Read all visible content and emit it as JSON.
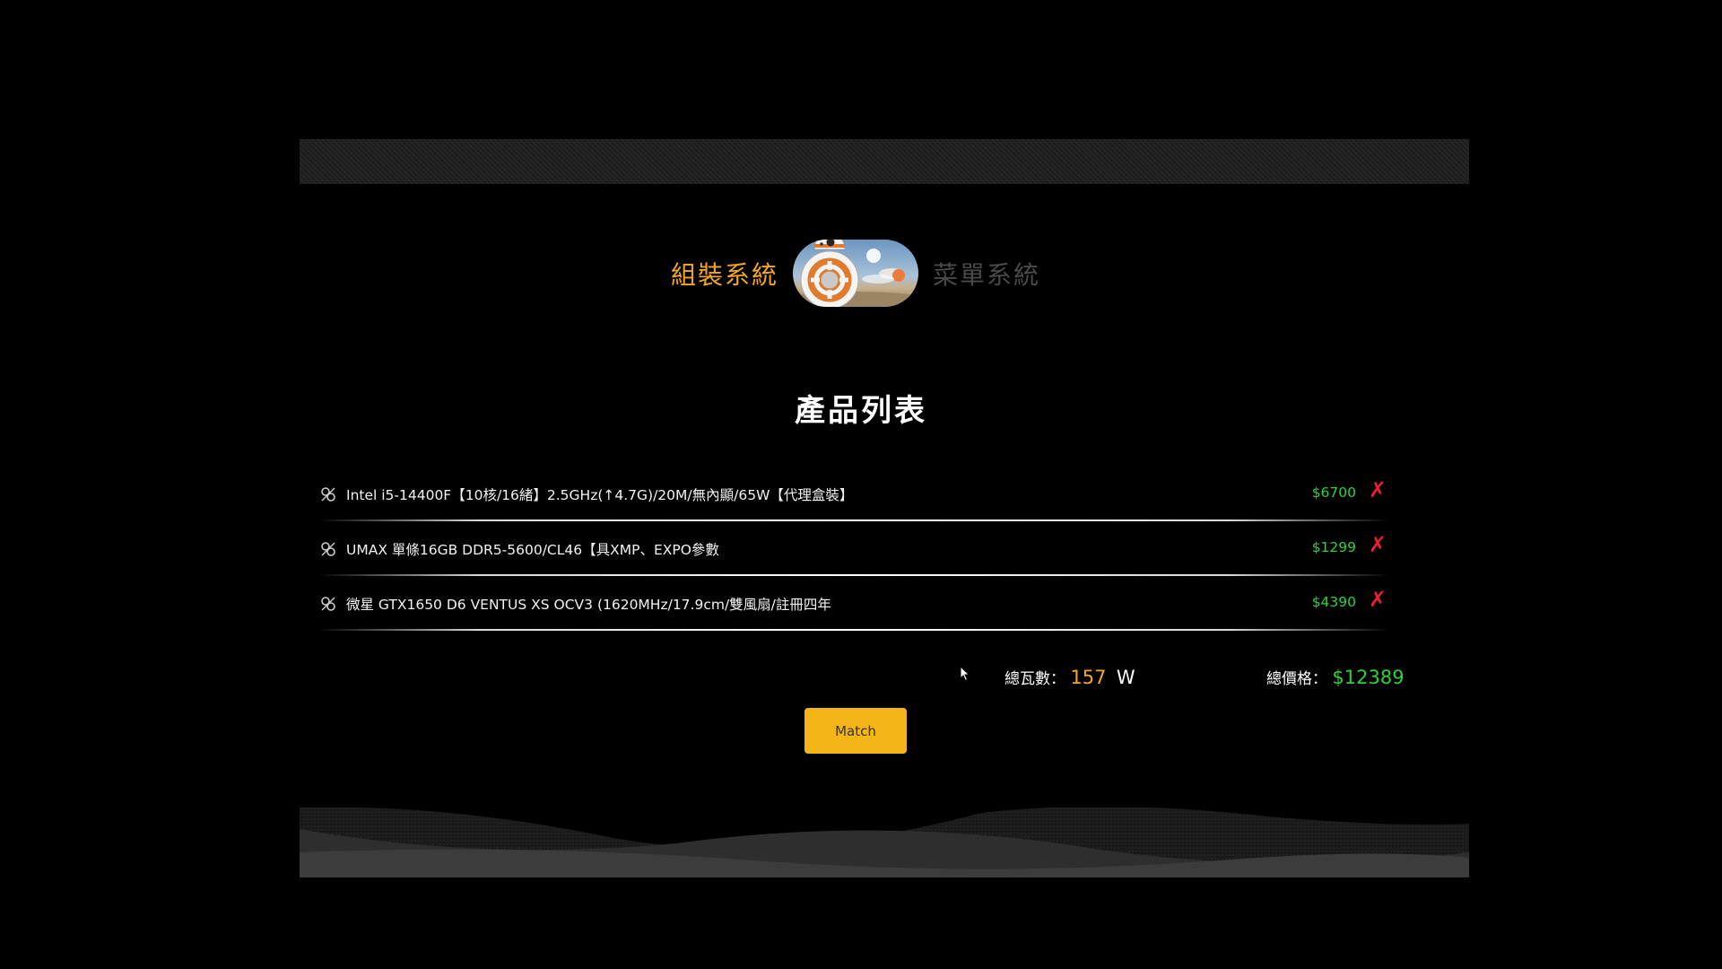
{
  "colors": {
    "accent_orange": "#f5a623",
    "muted_text": "#4a4a4a",
    "price_green": "#2dd13a",
    "delete_red": "#e8202a",
    "button_yellow": "#f3b616"
  },
  "mode_switch": {
    "left_label": "組裝系統",
    "right_label": "菜單系統",
    "active": "left"
  },
  "page_title": "產品列表",
  "items": [
    {
      "icon": "component-icon",
      "name": "Intel i5-14400F【10核/16緒】2.5GHz(↑4.7G)/20M/無內顯/65W【代理盒裝】",
      "price": "$6700",
      "remove": "✗"
    },
    {
      "icon": "component-icon",
      "name": "UMAX 單條16GB DDR5-5600/CL46【具XMP、EXPO參數",
      "price": "$1299",
      "remove": "✗"
    },
    {
      "icon": "component-icon",
      "name": "微星 GTX1650 D6 VENTUS XS OCV3 (1620MHz/17.9cm/雙風扇/註冊四年",
      "price": "$4390",
      "remove": "✗"
    }
  ],
  "summary": {
    "watt_label": "總瓦數：",
    "watt_value": "157",
    "watt_unit": "W",
    "price_label": "總價格：",
    "price_value": "$12389"
  },
  "match_button": {
    "label": "Match"
  }
}
